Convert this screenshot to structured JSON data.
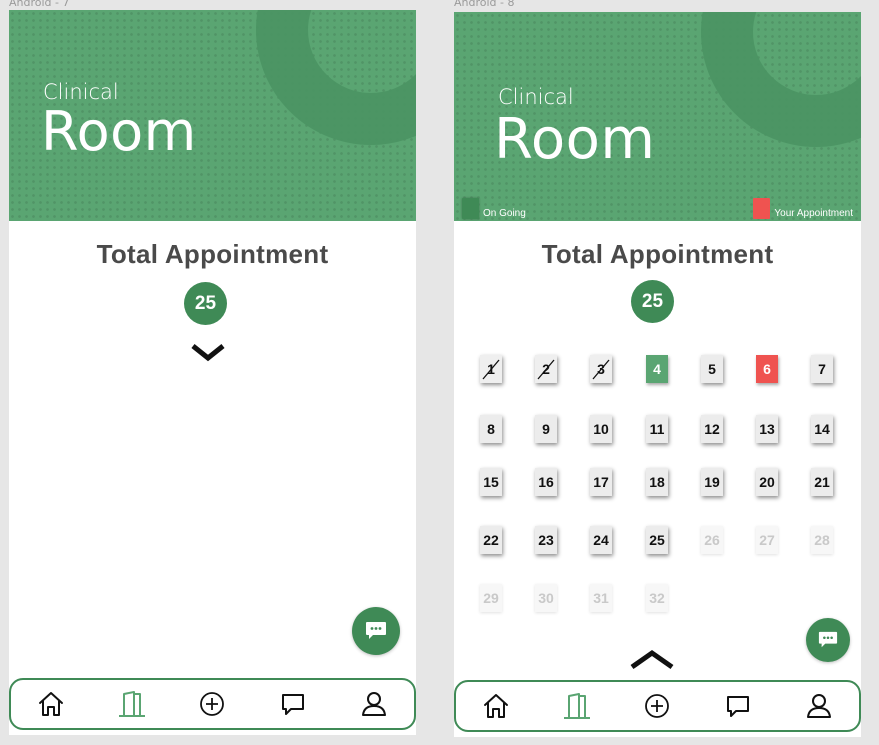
{
  "frames": {
    "left_label": "Android - 7",
    "right_label": "Android - 8"
  },
  "header": {
    "subtitle": "Clinical",
    "title": "Room"
  },
  "legend": {
    "ongoing_label": "On Going",
    "yours_label": "Your Appointment",
    "ongoing_color": "#3f8a56",
    "yours_color": "#ef5350"
  },
  "summary": {
    "title": "Total Appointment",
    "count": "25"
  },
  "colors": {
    "brand_green": "#5aa572",
    "badge_green": "#3f8a56",
    "accent_red": "#ef5350"
  },
  "slots": [
    {
      "n": "1",
      "state": "done"
    },
    {
      "n": "2",
      "state": "done"
    },
    {
      "n": "3",
      "state": "done"
    },
    {
      "n": "4",
      "state": "ongoing"
    },
    {
      "n": "5",
      "state": "waiting"
    },
    {
      "n": "6",
      "state": "yours"
    },
    {
      "n": "7",
      "state": "waiting"
    },
    {
      "n": "8",
      "state": "waiting"
    },
    {
      "n": "9",
      "state": "waiting"
    },
    {
      "n": "10",
      "state": "waiting"
    },
    {
      "n": "11",
      "state": "waiting"
    },
    {
      "n": "12",
      "state": "waiting"
    },
    {
      "n": "13",
      "state": "waiting"
    },
    {
      "n": "14",
      "state": "waiting"
    },
    {
      "n": "15",
      "state": "waiting"
    },
    {
      "n": "16",
      "state": "waiting"
    },
    {
      "n": "17",
      "state": "waiting"
    },
    {
      "n": "18",
      "state": "waiting"
    },
    {
      "n": "19",
      "state": "waiting"
    },
    {
      "n": "20",
      "state": "waiting"
    },
    {
      "n": "21",
      "state": "waiting"
    },
    {
      "n": "22",
      "state": "waiting"
    },
    {
      "n": "23",
      "state": "waiting"
    },
    {
      "n": "24",
      "state": "waiting"
    },
    {
      "n": "25",
      "state": "waiting"
    },
    {
      "n": "26",
      "state": "disabled"
    },
    {
      "n": "27",
      "state": "disabled"
    },
    {
      "n": "28",
      "state": "disabled"
    },
    {
      "n": "29",
      "state": "disabled"
    },
    {
      "n": "30",
      "state": "disabled"
    },
    {
      "n": "31",
      "state": "disabled"
    },
    {
      "n": "32",
      "state": "disabled"
    }
  ],
  "nav": [
    {
      "name": "home-icon",
      "active": false
    },
    {
      "name": "door-icon",
      "active": true
    },
    {
      "name": "plus-circle-icon",
      "active": false
    },
    {
      "name": "chat-icon",
      "active": false
    },
    {
      "name": "user-icon",
      "active": false
    }
  ]
}
